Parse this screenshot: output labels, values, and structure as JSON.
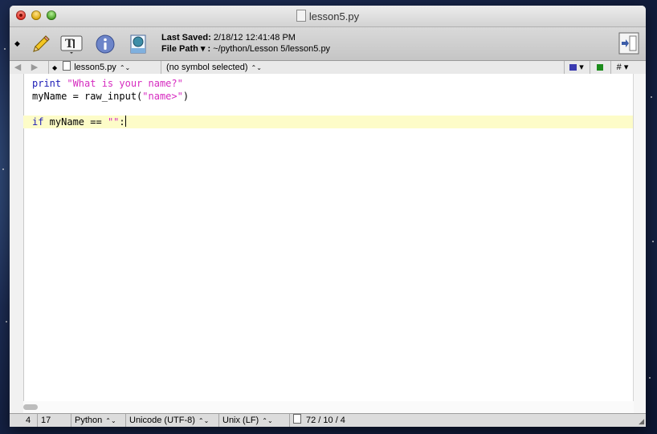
{
  "window": {
    "title": "lesson5.py"
  },
  "toolbar": {
    "last_saved_label": "Last Saved:",
    "last_saved_value": "2/18/12 12:41:48 PM",
    "file_path_label": "File Path ▾ :",
    "file_path_value": "~/python/Lesson 5/lesson5.py"
  },
  "navbar": {
    "file_name": "lesson5.py",
    "symbol": "(no symbol selected)",
    "hash": "#"
  },
  "code": {
    "lines": [
      {
        "kw": "print",
        "rest_pre": " ",
        "str": "\"What is your name?\"",
        "rest_post": ""
      },
      {
        "kw": "",
        "rest_pre": "myName = raw_input(",
        "str": "\"name>\"",
        "rest_post": ")"
      },
      {
        "kw": "",
        "rest_pre": "",
        "str": "",
        "rest_post": ""
      },
      {
        "kw": "if",
        "rest_pre": " myName == ",
        "str": "\"\"",
        "rest_post": ":"
      }
    ]
  },
  "status": {
    "line": "4",
    "column": "17",
    "language": "Python",
    "encoding": "Unicode (UTF-8)",
    "line_endings": "Unix (LF)",
    "counts": "72 / 10 / 4"
  },
  "colors": {
    "keyword": "#1a1ab5",
    "string": "#d62bc0",
    "current_line": "#fdfcc8"
  }
}
